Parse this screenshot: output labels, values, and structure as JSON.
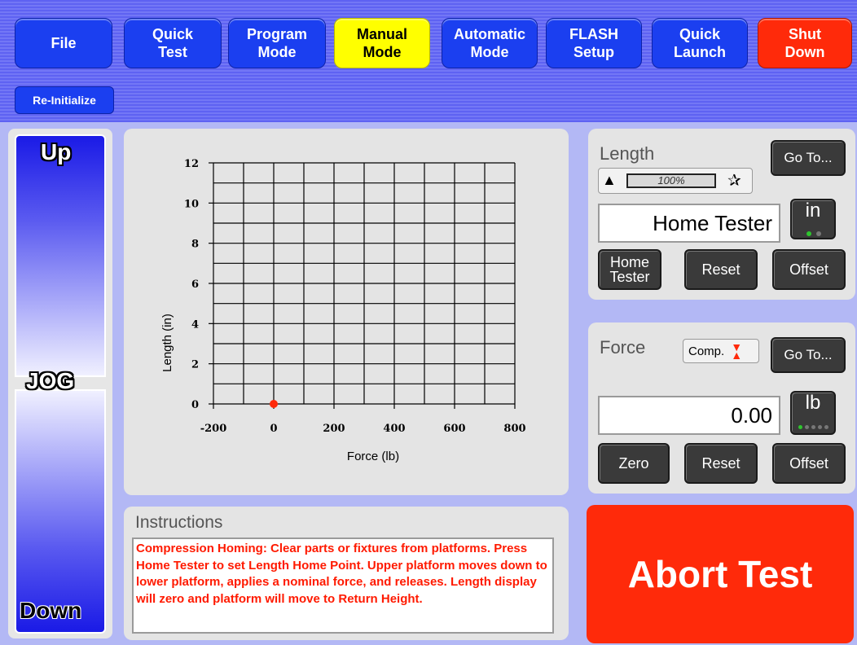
{
  "nav": {
    "file": "File",
    "quick_test": "Quick\nTest",
    "program_mode": "Program\nMode",
    "manual_mode": "Manual\nMode",
    "automatic_mode": "Automatic\nMode",
    "flash_setup": "FLASH\nSetup",
    "quick_launch": "Quick\nLaunch",
    "shut_down": "Shut\nDown",
    "reinitialize": "Re-Initialize"
  },
  "jog": {
    "up": "Up",
    "label": "JOG",
    "down": "Down"
  },
  "chart_data": {
    "type": "scatter",
    "xlabel": "Force (lb)",
    "ylabel": "Length (in)",
    "xlim": [
      -200,
      800
    ],
    "ylim": [
      0,
      12
    ],
    "x_ticks": [
      "-200",
      "0",
      "200",
      "400",
      "600",
      "800"
    ],
    "y_ticks": [
      "0",
      "2",
      "4",
      "6",
      "8",
      "10",
      "12"
    ],
    "grid": true,
    "series": [
      {
        "color": "#ff2a0a",
        "points": [
          {
            "x": 0,
            "y": 0
          }
        ]
      }
    ]
  },
  "instructions": {
    "title": "Instructions",
    "text": "Compression Homing: Clear parts or fixtures from platforms.  Press Home Tester to set Length Home Point.  Upper platform moves down to lower platform, applies a nominal force, and releases.  Length display will zero and platform will move to Return Height."
  },
  "length": {
    "label": "Length",
    "goto": "Go To...",
    "speed": "100%",
    "display": "Home Tester",
    "unit": "in",
    "home_tester": "Home\nTester",
    "reset": "Reset",
    "offset": "Offset"
  },
  "force": {
    "label": "Force",
    "mode": "Comp.",
    "goto": "Go To...",
    "display": "0.00",
    "unit": "lb",
    "zero": "Zero",
    "reset": "Reset",
    "offset": "Offset"
  },
  "abort": "Abort Test",
  "colors": {
    "nav_blue": "#1b3ff0",
    "active_yellow": "#ffff00",
    "danger_red": "#ff2a0a",
    "instruction_text": "#ff1a00"
  }
}
